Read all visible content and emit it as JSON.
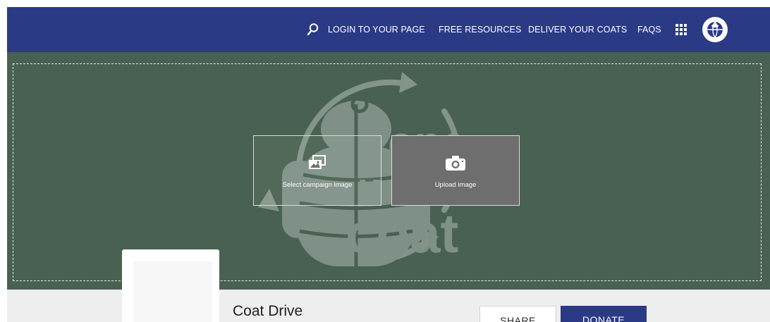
{
  "nav": {
    "search_icon": "search-icon",
    "links": [
      "LOGIN TO YOUR PAGE",
      "FREE RESOURCES",
      "DELIVER YOUR COATS",
      "FAQS"
    ],
    "grid_icon": "grid-icon",
    "avatar_icon": "globe-logo-icon"
  },
  "banner": {
    "watermark_text": "one warm coat",
    "select_image": {
      "icon": "image-stack-icon",
      "label": "Select campaign image"
    },
    "upload_image": {
      "icon": "camera-icon",
      "label": "Upload image"
    }
  },
  "profile": {
    "title": "Coat Drive",
    "share_label": "SHARE",
    "donate_label": "DONATE"
  },
  "colors": {
    "nav_bg": "#2b3a85",
    "banner_bg": "#496152",
    "strip_bg": "#eeeeee",
    "donate_bg": "#2b3a85"
  }
}
